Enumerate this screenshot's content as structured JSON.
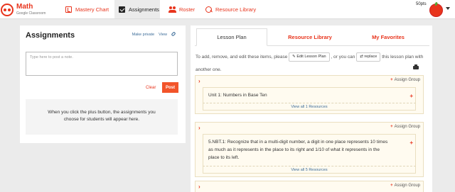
{
  "nav": {
    "app_title": "Math",
    "app_subtitle": "Google Classroom",
    "items": [
      {
        "label": "Mastery Chart",
        "icon": "chart-icon"
      },
      {
        "label": "Assignments",
        "icon": "checkbox-icon"
      },
      {
        "label": "Roster",
        "icon": "people-icon"
      },
      {
        "label": "Resource Library",
        "icon": "search-icon"
      }
    ],
    "points": "50pts"
  },
  "assignments": {
    "title": "Assignments",
    "make_private": "Make private",
    "view": "View",
    "note_placeholder": "Type here to post a note.",
    "clear_label": "Clear",
    "post_label": "Post",
    "empty_message": "When you click the plus button, the assignments you choose for students will appear here."
  },
  "lesson": {
    "tabs": [
      "Lesson Plan",
      "Resource Library",
      "My Favorites"
    ],
    "instr_part1": "To add, remove, and edit these items, please",
    "edit_button": "Edit Lesson Plan",
    "instr_part2": ", or you can",
    "replace_button": "replace",
    "instr_part3": "this lesson plan with another one.",
    "groups": [
      {
        "assign": "Assign Group",
        "text": "Unit 1: Numbers in Base Ten",
        "view_all": "View all 1 Resources"
      },
      {
        "assign": "Assign Group",
        "text": "5.NBT.1: Recognize that in a multi-digit number, a digit in one place represents 10 times as much as it represents in the place to its right and 1/10 of what it represents in the place to its left.",
        "view_all": "View all 5 Resources"
      },
      {
        "assign": "Assign Group"
      }
    ]
  },
  "colors": {
    "accent": "#e8341c",
    "link": "#3d6d99",
    "group_bg": "#fffbf0"
  }
}
